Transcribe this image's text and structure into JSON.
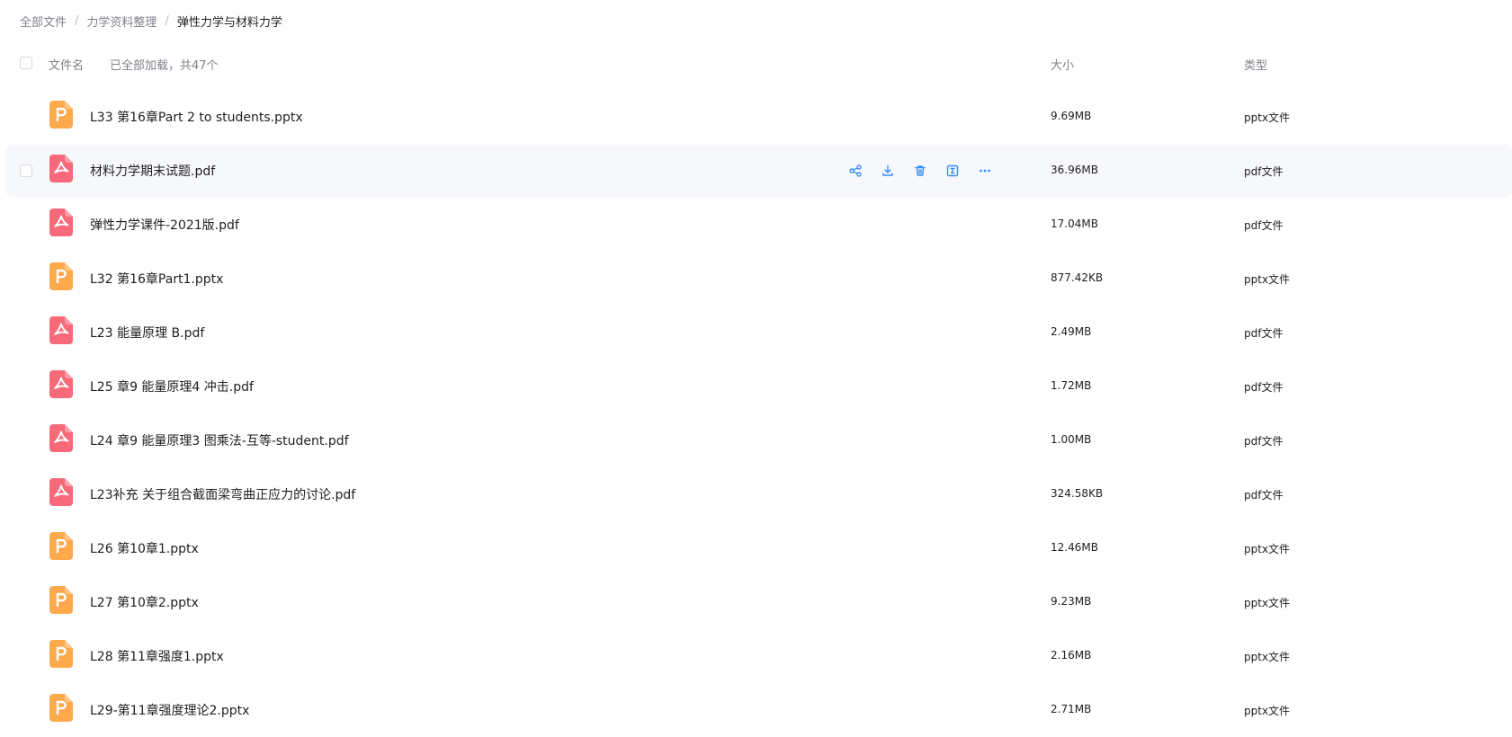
{
  "breadcrumb": [
    "全部文件",
    "力学资料整理",
    "弹性力学与材料力学"
  ],
  "header": {
    "name_label": "文件名",
    "loaded_label": "已全部加载，共47个",
    "size_label": "大小",
    "type_label": "类型"
  },
  "colors": {
    "pptx_icon": "#ffa94d",
    "pdf_icon": "#f86a7a",
    "action_icon": "#3c8cf7",
    "hover_row": "#f6f8fb"
  },
  "files": [
    {
      "name": "L33 第16章Part 2 to students.pptx",
      "size": "9.69MB",
      "type": "pptx文件",
      "kind": "pptx"
    },
    {
      "name": "材料力学期末试题.pdf",
      "size": "36.96MB",
      "type": "pdf文件",
      "kind": "pdf",
      "hovered": true
    },
    {
      "name": "弹性力学课件-2021版.pdf",
      "size": "17.04MB",
      "type": "pdf文件",
      "kind": "pdf"
    },
    {
      "name": "L32 第16章Part1.pptx",
      "size": "877.42KB",
      "type": "pptx文件",
      "kind": "pptx"
    },
    {
      "name": "L23 能量原理 B.pdf",
      "size": "2.49MB",
      "type": "pdf文件",
      "kind": "pdf"
    },
    {
      "name": "L25 章9 能量原理4 冲击.pdf",
      "size": "1.72MB",
      "type": "pdf文件",
      "kind": "pdf"
    },
    {
      "name": "L24 章9 能量原理3 图乘法-互等-student.pdf",
      "size": "1.00MB",
      "type": "pdf文件",
      "kind": "pdf"
    },
    {
      "name": "L23补充 关于组合截面梁弯曲正应力的讨论.pdf",
      "size": "324.58KB",
      "type": "pdf文件",
      "kind": "pdf"
    },
    {
      "name": "L26 第10章1.pptx",
      "size": "12.46MB",
      "type": "pptx文件",
      "kind": "pptx"
    },
    {
      "name": "L27 第10章2.pptx",
      "size": "9.23MB",
      "type": "pptx文件",
      "kind": "pptx"
    },
    {
      "name": "L28 第11章强度1.pptx",
      "size": "2.16MB",
      "type": "pptx文件",
      "kind": "pptx"
    },
    {
      "name": "L29-第11章强度理论2.pptx",
      "size": "2.71MB",
      "type": "pptx文件",
      "kind": "pptx"
    }
  ],
  "row_actions": [
    "share-icon",
    "download-icon",
    "trash-icon",
    "rename-icon",
    "more-icon"
  ]
}
